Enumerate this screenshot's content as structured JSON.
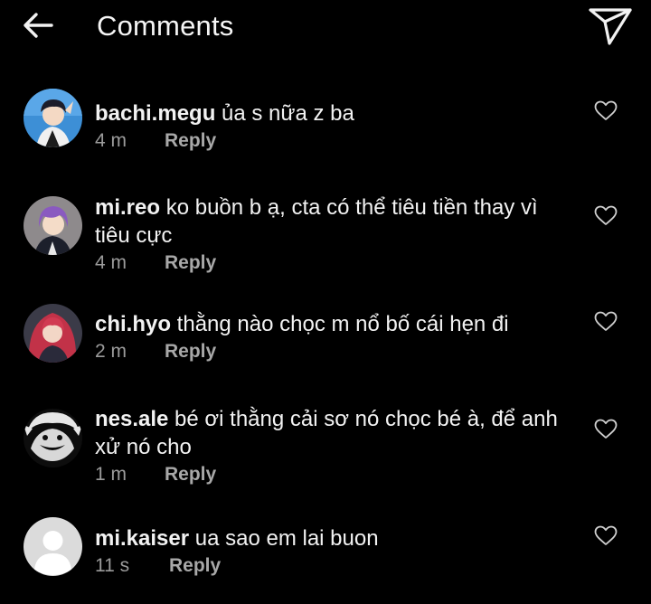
{
  "header": {
    "title": "Comments",
    "back_icon": "arrow-left-icon",
    "send_icon": "paper-plane-icon"
  },
  "comments": [
    {
      "username": "bachi.megu",
      "text": " ủa s nữa z ba",
      "time": "4 m",
      "reply": "Reply"
    },
    {
      "username": "mi.reo",
      "text": " ko buồn b ạ, cta có thể tiêu tiền thay vì tiêu cực",
      "time": "4 m",
      "reply": "Reply"
    },
    {
      "username": "chi.hyo",
      "text": " thằng nào chọc m nổ bố cái hẹn đi",
      "time": "2 m",
      "reply": "Reply"
    },
    {
      "username": "nes.ale",
      "text": " bé ơi thằng cải sơ nó chọc bé à, để anh xử nó cho",
      "time": "1 m",
      "reply": "Reply"
    },
    {
      "username": "mi.kaiser",
      "text": " ua sao em lai buon",
      "time": "11 s",
      "reply": "Reply"
    }
  ],
  "colors": {
    "background": "#000000",
    "text": "#f2f2f2",
    "muted": "#9b9b9b",
    "icon": "#cfcfcf"
  }
}
